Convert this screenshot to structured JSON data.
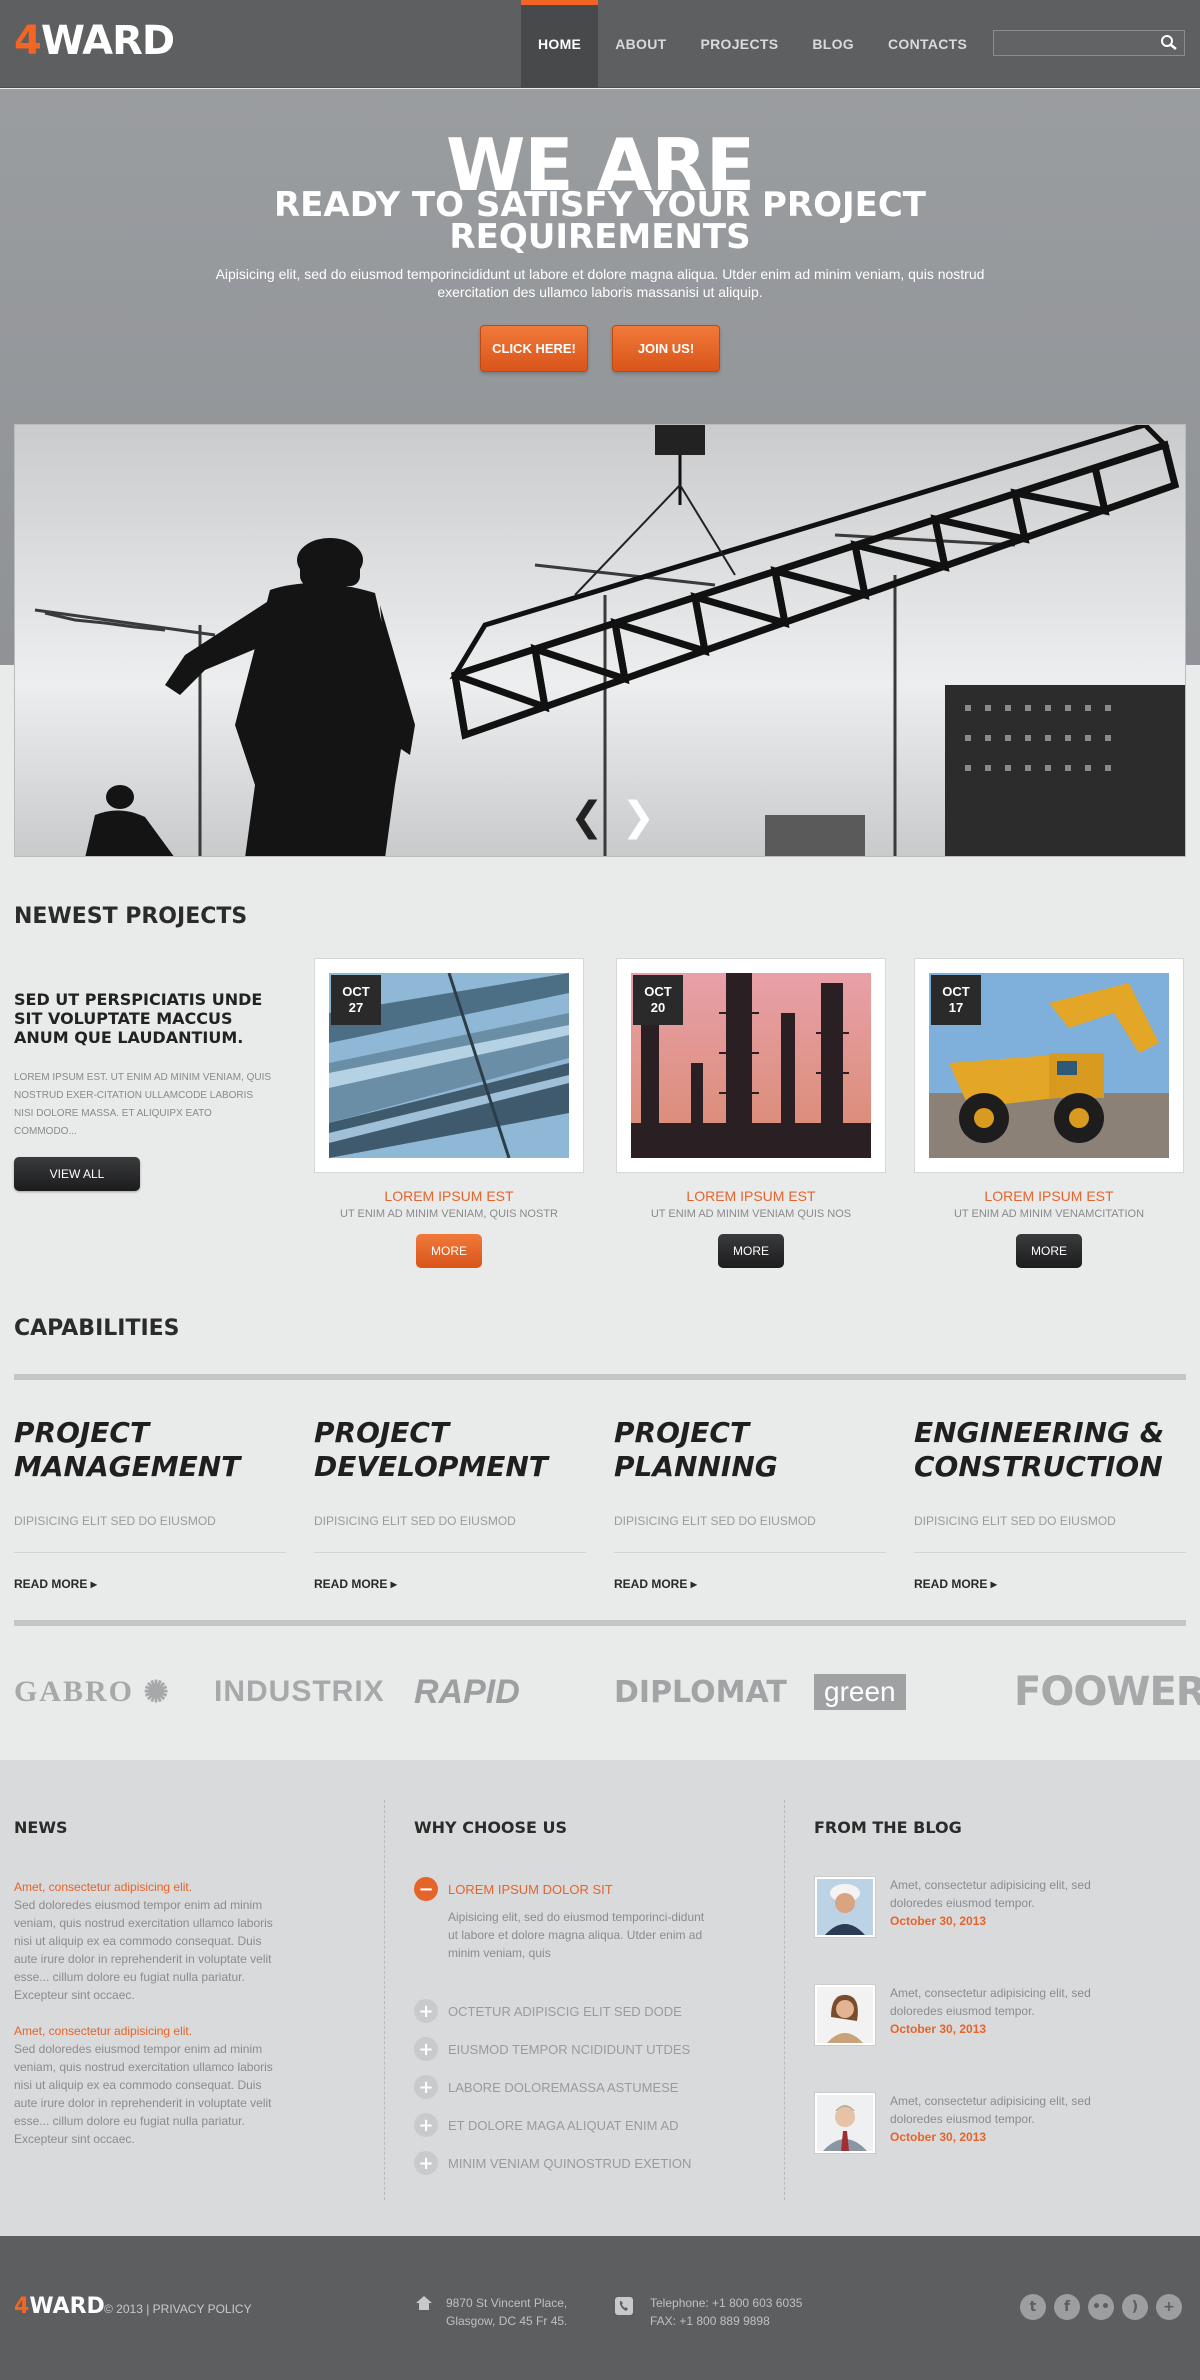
{
  "brand": {
    "num": "4",
    "name": "WARD"
  },
  "nav": {
    "items": [
      "HOME",
      "ABOUT",
      "PROJECTS",
      "BLOG",
      "CONTACTS"
    ],
    "active": "HOME"
  },
  "search": {
    "placeholder": "",
    "icon": "search-icon"
  },
  "hero": {
    "headline": "WE ARE",
    "subheadline_1": "READY TO SATISFY YOUR PROJECT",
    "subheadline_2": "REQUIREMENTS",
    "text": "Aipisicing elit, sed do eiusmod temporincididunt ut labore et dolore magna aliqua. Utder enim ad minim veniam, quis nostrud exercitation des ullamco laboris massanisi ut aliquip.",
    "btn_click": "CLICK HERE!",
    "btn_join": "JOIN US!"
  },
  "slider": {
    "prev": "❮",
    "next": "❯"
  },
  "newest": {
    "title": "NEWEST PROJECTS",
    "intro_title": "SED UT PERSPICIATIS UNDE SIT VOLUPTATE MACCUS ANUM QUE LAUDANTIUM.",
    "intro_text": "LOREM IPSUM EST. UT ENIM AD MINIM VENIAM, QUIS NOSTRUD EXER-CITATION ULLAMCODE LABORIS NISI DOLORE MASSA. ET ALIQUIPX EATO COMMODO...",
    "view_all": "VIEW ALL",
    "projects": [
      {
        "month": "OCT",
        "day": "27",
        "title": "LOREM IPSUM EST",
        "sub": "UT ENIM AD MINIM VENIAM, QUIS NOSTR",
        "btn": "MORE",
        "image": "industrial-pipes-photo",
        "btn_color": "orange"
      },
      {
        "month": "OCT",
        "day": "20",
        "title": "LOREM IPSUM EST",
        "sub": "UT ENIM AD MINIM VENIAM QUIS NOS",
        "btn": "MORE",
        "image": "refinery-towers-photo",
        "btn_color": "dark"
      },
      {
        "month": "OCT",
        "day": "17",
        "title": "LOREM IPSUM EST",
        "sub": "UT ENIM AD MINIM VENAMCITATION",
        "btn": "MORE",
        "image": "mining-truck-photo",
        "btn_color": "dark"
      }
    ]
  },
  "capabilities": {
    "title": "CAPABILITIES",
    "items": [
      {
        "line1": "PROJECT",
        "line2": "MANAGEMENT",
        "text": "DIPISICING ELIT SED DO EIUSMOD",
        "link": "READ MORE"
      },
      {
        "line1": "PROJECT",
        "line2": "DEVELOPMENT",
        "text": "DIPISICING ELIT SED DO EIUSMOD",
        "link": "READ MORE"
      },
      {
        "line1": "PROJECT",
        "line2": "PLANNING",
        "text": "DIPISICING ELIT SED DO EIUSMOD",
        "link": "READ MORE"
      },
      {
        "line1": "ENGINEERING &",
        "line2": "CONSTRUCTION",
        "text": "DIPISICING ELIT SED DO EIUSMOD",
        "link": "READ MORE"
      }
    ]
  },
  "partners": [
    "GABRO",
    "INDUSTRIX",
    "RAPID",
    "DIPLOMAT",
    "green",
    "FOOWER"
  ],
  "news": {
    "title": "NEWS",
    "items": [
      {
        "title": "Amet, consectetur adipisicing elit.",
        "text": "Sed doloredes eiusmod tempor enim ad minim veniam, quis nostrud exercitation ullamco laboris nisi ut aliquip ex ea commodo consequat. Duis aute irure dolor in reprehenderit in voluptate velit esse... cillum dolore eu fugiat nulla pariatur. Excepteur sint occaec."
      },
      {
        "title": "Amet, consectetur adipisicing elit.",
        "text": "Sed doloredes eiusmod tempor enim ad minim veniam, quis nostrud exercitation ullamco laboris nisi ut aliquip ex ea commodo consequat. Duis aute irure dolor in reprehenderit in voluptate velit esse... cillum dolore eu fugiat nulla pariatur. Excepteur sint occaec."
      }
    ]
  },
  "why": {
    "title": "WHY CHOOSE US",
    "open_item": "LOREM IPSUM DOLOR SIT",
    "open_text": "Aipisicing elit, sed do eiusmod temporinci-didunt ut labore et dolore magna aliqua. Utder enim ad minim veniam, quis",
    "items": [
      "OCTETUR ADIPISCIG ELIT SED DODE",
      "EIUSMOD TEMPOR NCIDIDUNT UTDES",
      "LABORE DOLOREMASSA ASTUMESE",
      "ET DOLORE MAGA ALIQUAT ENIM AD",
      "MINIM VENIAM QUINOSTRUD EXETION"
    ],
    "minus": "−",
    "plus": "+"
  },
  "blog": {
    "title": "FROM THE BLOG",
    "items": [
      {
        "text": "Amet, consectetur adipisicing elit, sed doloredes eiusmod tempor.",
        "date": "October 30, 2013",
        "thumb": "worker-helmet-avatar"
      },
      {
        "text": "Amet, consectetur adipisicing elit, sed doloredes eiusmod tempor.",
        "date": "October 30, 2013",
        "thumb": "woman-avatar"
      },
      {
        "text": "Amet, consectetur adipisicing elit, sed doloredes eiusmod tempor.",
        "date": "October 30, 2013",
        "thumb": "businessman-avatar"
      }
    ]
  },
  "footer": {
    "copyright": "© 2013 |",
    "privacy": "PRIVACY POLICY",
    "address_1": "9870 St Vincent Place,",
    "address_2": "Glasgow, DC 45 Fr 45.",
    "phone_1": "Telephone: +1 800 603 6035",
    "phone_2": "FAX:        +1 800 889 9898",
    "social": [
      "twitter-icon",
      "facebook-icon",
      "flickr-icon",
      "rss-icon",
      "plus-icon"
    ]
  },
  "colors": {
    "accent": "#f26522",
    "header": "#5d5f61",
    "footer": "#5c5e60",
    "dark_button": "#1c1c1d"
  }
}
